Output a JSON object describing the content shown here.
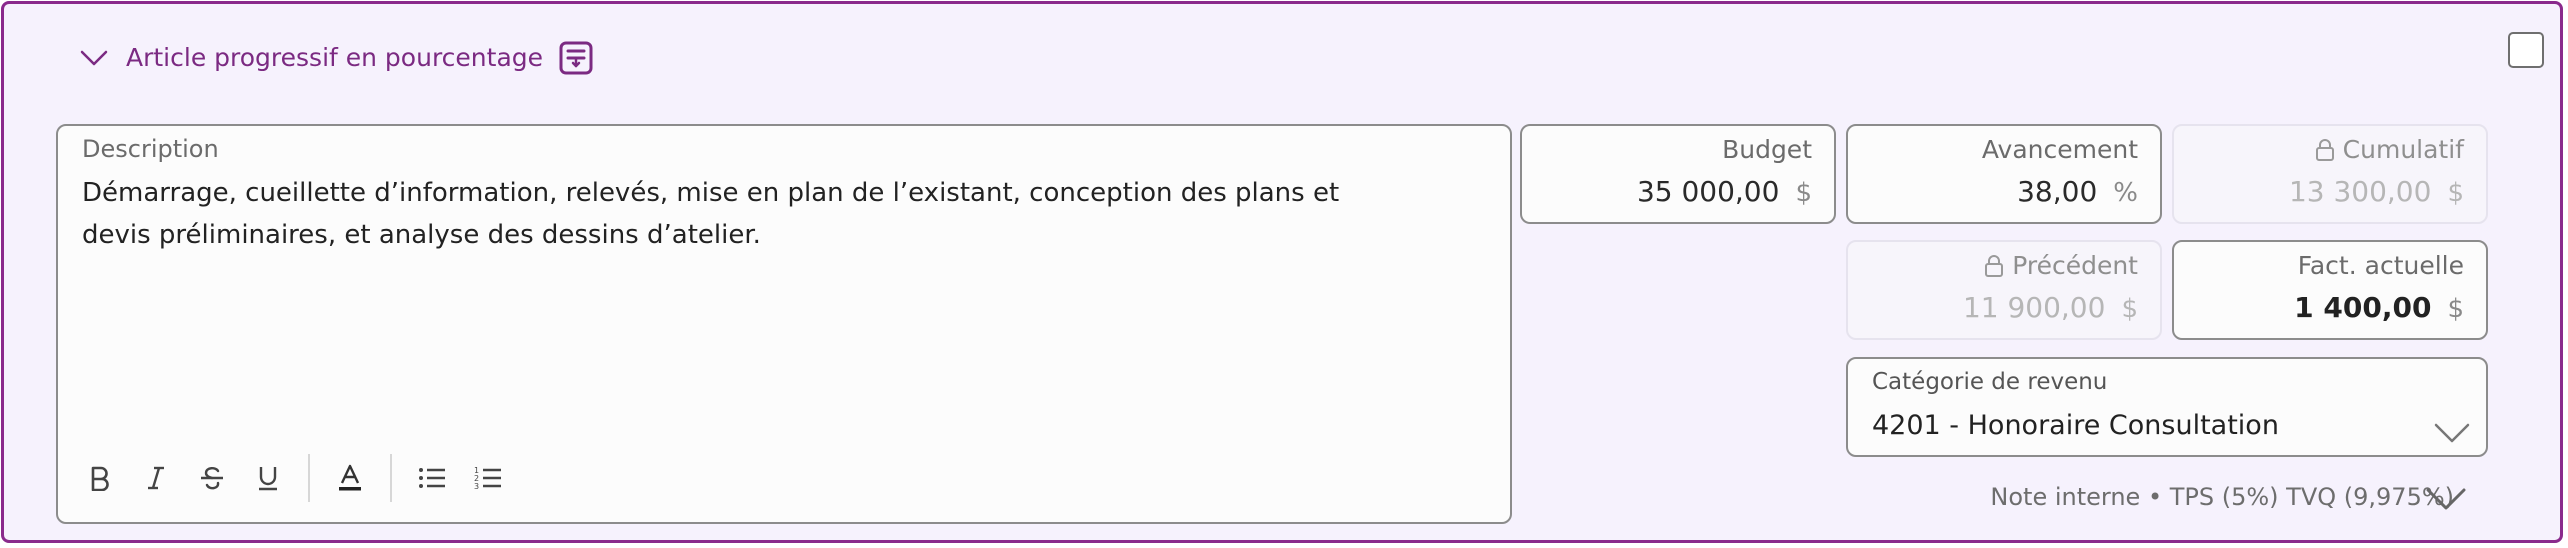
{
  "item": {
    "title": "Article progressif en pourcentage",
    "icons": {
      "collapse": "chevron-down-icon",
      "action": "progress-item-icon",
      "select": "checkbox"
    }
  },
  "description": {
    "label": "Description",
    "text": "Démarrage, cueillette d’information, relevés, mise en plan de l’existant, conception des plans et devis préliminaires, et analyse des dessins d’atelier.",
    "toolbar": [
      "bold",
      "italic",
      "strikethrough",
      "underline",
      "text-color",
      "bullet-list",
      "numbered-list"
    ]
  },
  "fields": {
    "budget": {
      "label": "Budget",
      "value": "35 000,00",
      "unit": "$"
    },
    "avancement": {
      "label": "Avancement",
      "value": "38,00",
      "unit": "%"
    },
    "cumulatif": {
      "label": "Cumulatif",
      "value": "13 300,00",
      "unit": "$",
      "locked": true
    },
    "precedent": {
      "label": "Précédent",
      "value": "11 900,00",
      "unit": "$",
      "locked": true
    },
    "fact_actuelle": {
      "label": "Fact. actuelle",
      "value": "1 400,00",
      "unit": "$"
    }
  },
  "category": {
    "label": "Catégorie de revenu",
    "value": "4201 - Honoraire Consultation"
  },
  "footer": {
    "note": "Note interne • TPS (5%) TVQ (9,975%)"
  },
  "colors": {
    "accent": "#7b2a82",
    "border_accent": "#8a2a8c",
    "card_bg": "#f6f2fd",
    "field_border": "#8c8c8c"
  }
}
